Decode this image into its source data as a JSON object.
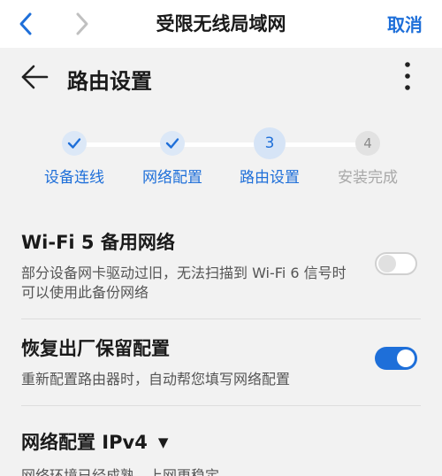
{
  "navbar": {
    "title": "受限无线局域网",
    "cancel_label": "取消",
    "back_icon": "chevron-left-icon",
    "forward_icon": "chevron-right-icon"
  },
  "header": {
    "title": "路由设置",
    "back_icon": "arrow-left-icon",
    "more_icon": "more-vertical-icon"
  },
  "stepper": {
    "steps": [
      {
        "label": "设备连线",
        "state": "done",
        "marker": "✓"
      },
      {
        "label": "网络配置",
        "state": "done",
        "marker": "✓"
      },
      {
        "label": "路由设置",
        "state": "current",
        "marker": "3"
      },
      {
        "label": "安装完成",
        "state": "todo",
        "marker": "4"
      }
    ]
  },
  "settings": [
    {
      "title": "Wi-Fi 5 备用网络",
      "description": "部分设备网卡驱动过旧，无法扫描到 Wi-Fi 6 信号时可以使用此备份网络",
      "enabled": false
    },
    {
      "title": "恢复出厂保留配置",
      "description": "重新配置路由器时，自动帮您填写网络配置",
      "enabled": true
    }
  ],
  "network_section": {
    "title": "网络配置 IPv4",
    "caret": "▼",
    "description": "网络环境已经成熟，上网更稳定"
  },
  "colors": {
    "accent": "#1e6fd9",
    "background": "#f2f2f2",
    "step_todo": "#a8a8a8"
  }
}
